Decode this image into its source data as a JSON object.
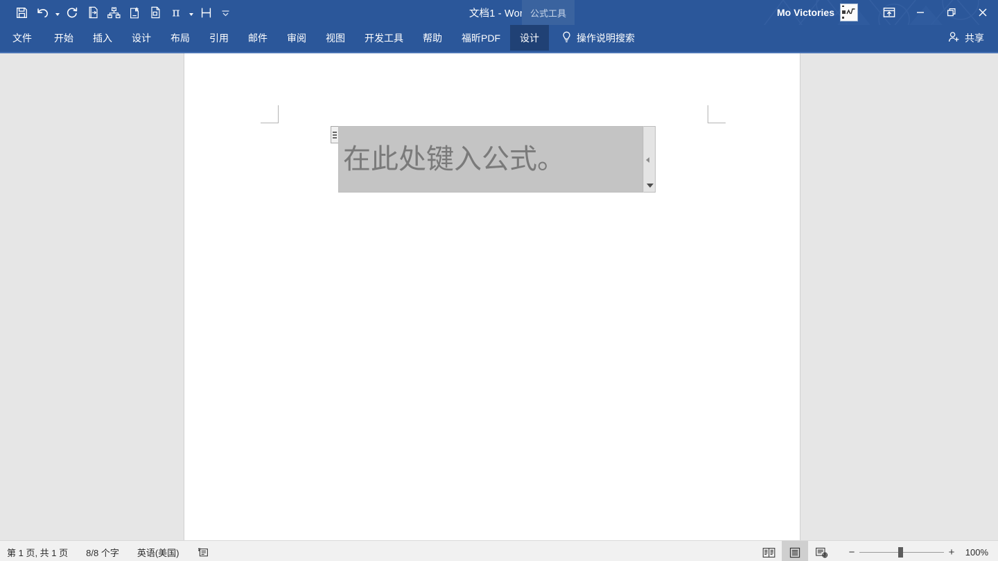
{
  "titlebar": {
    "quick_access": [
      {
        "name": "save-icon",
        "label": "保存",
        "has_caret": false
      },
      {
        "name": "undo-icon",
        "label": "撤消",
        "has_caret": true
      },
      {
        "name": "redo-icon",
        "label": "恢复",
        "has_caret": false
      },
      {
        "name": "export-pdf-icon",
        "label": "导出 PDF",
        "has_caret": false
      },
      {
        "name": "smartart-icon",
        "label": "SmartArt",
        "has_caret": false
      },
      {
        "name": "new-document-icon",
        "label": "新建",
        "has_caret": false
      },
      {
        "name": "page-setup-icon",
        "label": "页面设置",
        "has_caret": false
      },
      {
        "name": "equation-icon",
        "label": "公式",
        "has_caret": true
      },
      {
        "name": "paragraph-spacing-icon",
        "label": "段落间距",
        "has_caret": false
      }
    ],
    "customize_qat": "自定义快速访问工具栏",
    "document_title": "文档1  -  Word",
    "contextual_tab_group": "公式工具",
    "account_name": "Mo Victories",
    "avatar_name": "user-avatar",
    "ribbon_display_options": "功能区显示选项",
    "minimize": "最小化",
    "restore": "向下还原",
    "close": "关闭"
  },
  "ribbon": {
    "tabs": [
      {
        "label": "文件",
        "name": "tab-file",
        "active": false
      },
      {
        "label": "开始",
        "name": "tab-home",
        "active": false
      },
      {
        "label": "插入",
        "name": "tab-insert",
        "active": false
      },
      {
        "label": "设计",
        "name": "tab-design",
        "active": false
      },
      {
        "label": "布局",
        "name": "tab-layout",
        "active": false
      },
      {
        "label": "引用",
        "name": "tab-references",
        "active": false
      },
      {
        "label": "邮件",
        "name": "tab-mailings",
        "active": false
      },
      {
        "label": "审阅",
        "name": "tab-review",
        "active": false
      },
      {
        "label": "视图",
        "name": "tab-view",
        "active": false
      },
      {
        "label": "开发工具",
        "name": "tab-developer",
        "active": false
      },
      {
        "label": "帮助",
        "name": "tab-help",
        "active": false
      },
      {
        "label": "福昕PDF",
        "name": "tab-foxit-pdf",
        "active": false
      },
      {
        "label": "设计",
        "name": "tab-equation-design",
        "active": true
      }
    ],
    "tell_me": "操作说明搜索",
    "share": "共享"
  },
  "document": {
    "equation_placeholder": "在此处键入公式。",
    "content_control_handle": "内容控件手柄"
  },
  "statusbar": {
    "page_info": "第 1 页, 共 1 页",
    "word_count": "8/8 个字",
    "language": "英语(美国)",
    "proofing_icon": "proofing-errors-icon",
    "views": [
      {
        "label": "阅读视图",
        "name": "view-read-mode",
        "active": false
      },
      {
        "label": "页面视图",
        "name": "view-print-layout",
        "active": true
      },
      {
        "label": "Web 版式视图",
        "name": "view-web-layout",
        "active": false
      }
    ],
    "zoom_out": "−",
    "zoom_in": "+",
    "zoom_level": "100%"
  },
  "colors": {
    "word_blue": "#2b579a",
    "active_tab": "#204175",
    "contextual_group": "#3a639f",
    "doc_background": "#e6e6e6",
    "page_white": "#ffffff",
    "selection_gray": "#c4c4c4",
    "placeholder_gray": "#7a7a7a",
    "statusbar": "#f1f1f1"
  }
}
